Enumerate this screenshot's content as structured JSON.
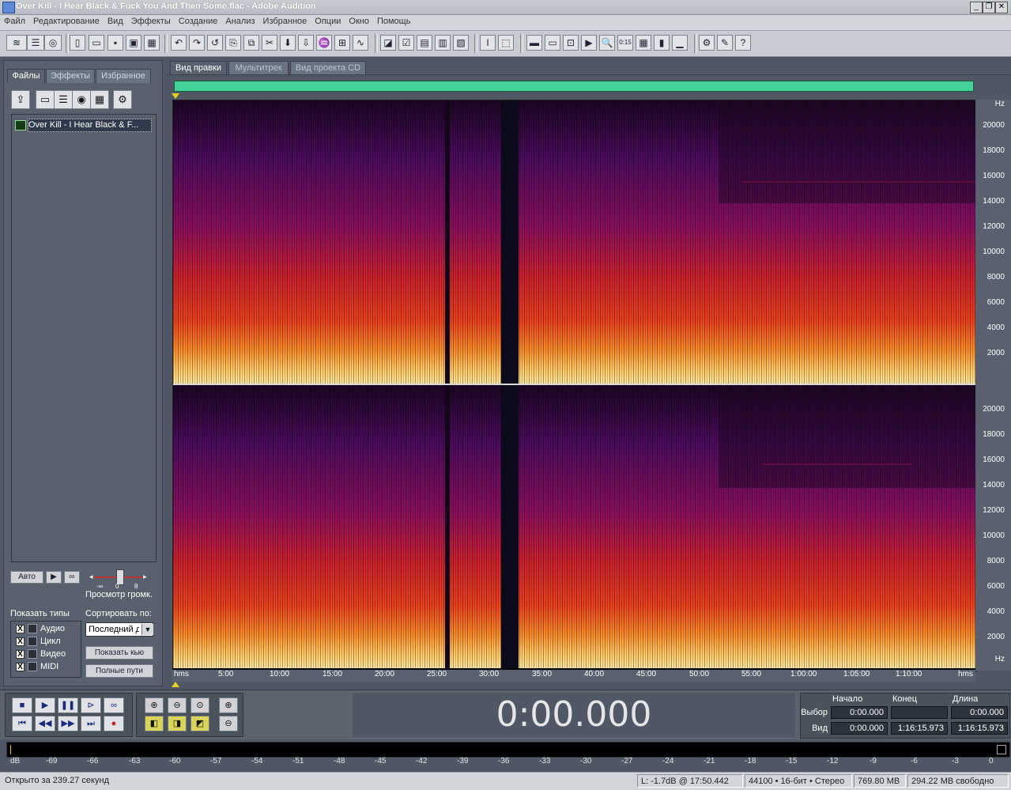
{
  "window": {
    "title": "Over Kill - I Hear Black & Fuck You And Then Some.flac - Adobe Audition",
    "min": "_",
    "restore": "❐",
    "close": "✕"
  },
  "menu": [
    "Файл",
    "Редактирование",
    "Вид",
    "Эффекты",
    "Создание",
    "Анализ",
    "Избранное",
    "Опции",
    "Окно",
    "Помощь"
  ],
  "left_panel": {
    "tabs": [
      "Файлы",
      "Эффекты",
      "Избранное"
    ],
    "file_name": "Over Kill - I Hear Black & F...",
    "auto_label": "Авто",
    "preview_label": "Просмотр громк.",
    "preview_scale": [
      "-∞",
      "0",
      "8"
    ],
    "show_types_label": "Показать типы",
    "sort_label": "Сортировать по:",
    "sort_value": "Последний д",
    "types": [
      {
        "label": "Аудио",
        "checked": "X"
      },
      {
        "label": "Цикл",
        "checked": "X"
      },
      {
        "label": "Видео",
        "checked": "X"
      },
      {
        "label": "MIDI",
        "checked": "X"
      }
    ],
    "cue_button": "Показать кью",
    "full_paths_button": "Полные пути"
  },
  "editor_tabs": [
    "Вид правки",
    "Мультитрек",
    "Вид проекта CD"
  ],
  "spectrogram": {
    "freq_labels": [
      "Hz",
      "20000",
      "18000",
      "16000",
      "14000",
      "12000",
      "10000",
      "8000",
      "6000",
      "4000",
      "2000",
      "Hz"
    ],
    "time_labels": [
      "hms",
      "5:00",
      "10:00",
      "15:00",
      "20:00",
      "25:00",
      "30:00",
      "35:00",
      "40:00",
      "45:00",
      "50:00",
      "55:00",
      "1:00:00",
      "1:05:00",
      "1:10:00",
      "hms"
    ]
  },
  "transport": {
    "time": "0:00.000",
    "headers": {
      "start": "Начало",
      "end": "Конец",
      "length": "Длина"
    },
    "rows": [
      {
        "label": "Выбор",
        "start": "0:00.000",
        "end": "",
        "length": "0:00.000"
      },
      {
        "label": "Вид",
        "start": "0:00.000",
        "end": "1:16:15.973",
        "length": "1:16:15.973"
      }
    ]
  },
  "meter_scale": [
    "dB",
    "-69",
    "-66",
    "-63",
    "-60",
    "-57",
    "-54",
    "-51",
    "-48",
    "-45",
    "-42",
    "-39",
    "-36",
    "-33",
    "-30",
    "-27",
    "-24",
    "-21",
    "-18",
    "-15",
    "-12",
    "-9",
    "-6",
    "-3",
    "0"
  ],
  "status": {
    "opened": "Открыто за 239.27 секунд",
    "level": "L: -1.7dB @  17:50.442",
    "format": "44100 • 16-бит • Стерео",
    "size": "769.80 MB",
    "free": "294.22 MB свободно"
  },
  "colors": {
    "panel": "#58616d",
    "overview": "#45d39a",
    "spectrum_hot": "#ffb347",
    "spectrum_cold": "#3a0a4a"
  }
}
